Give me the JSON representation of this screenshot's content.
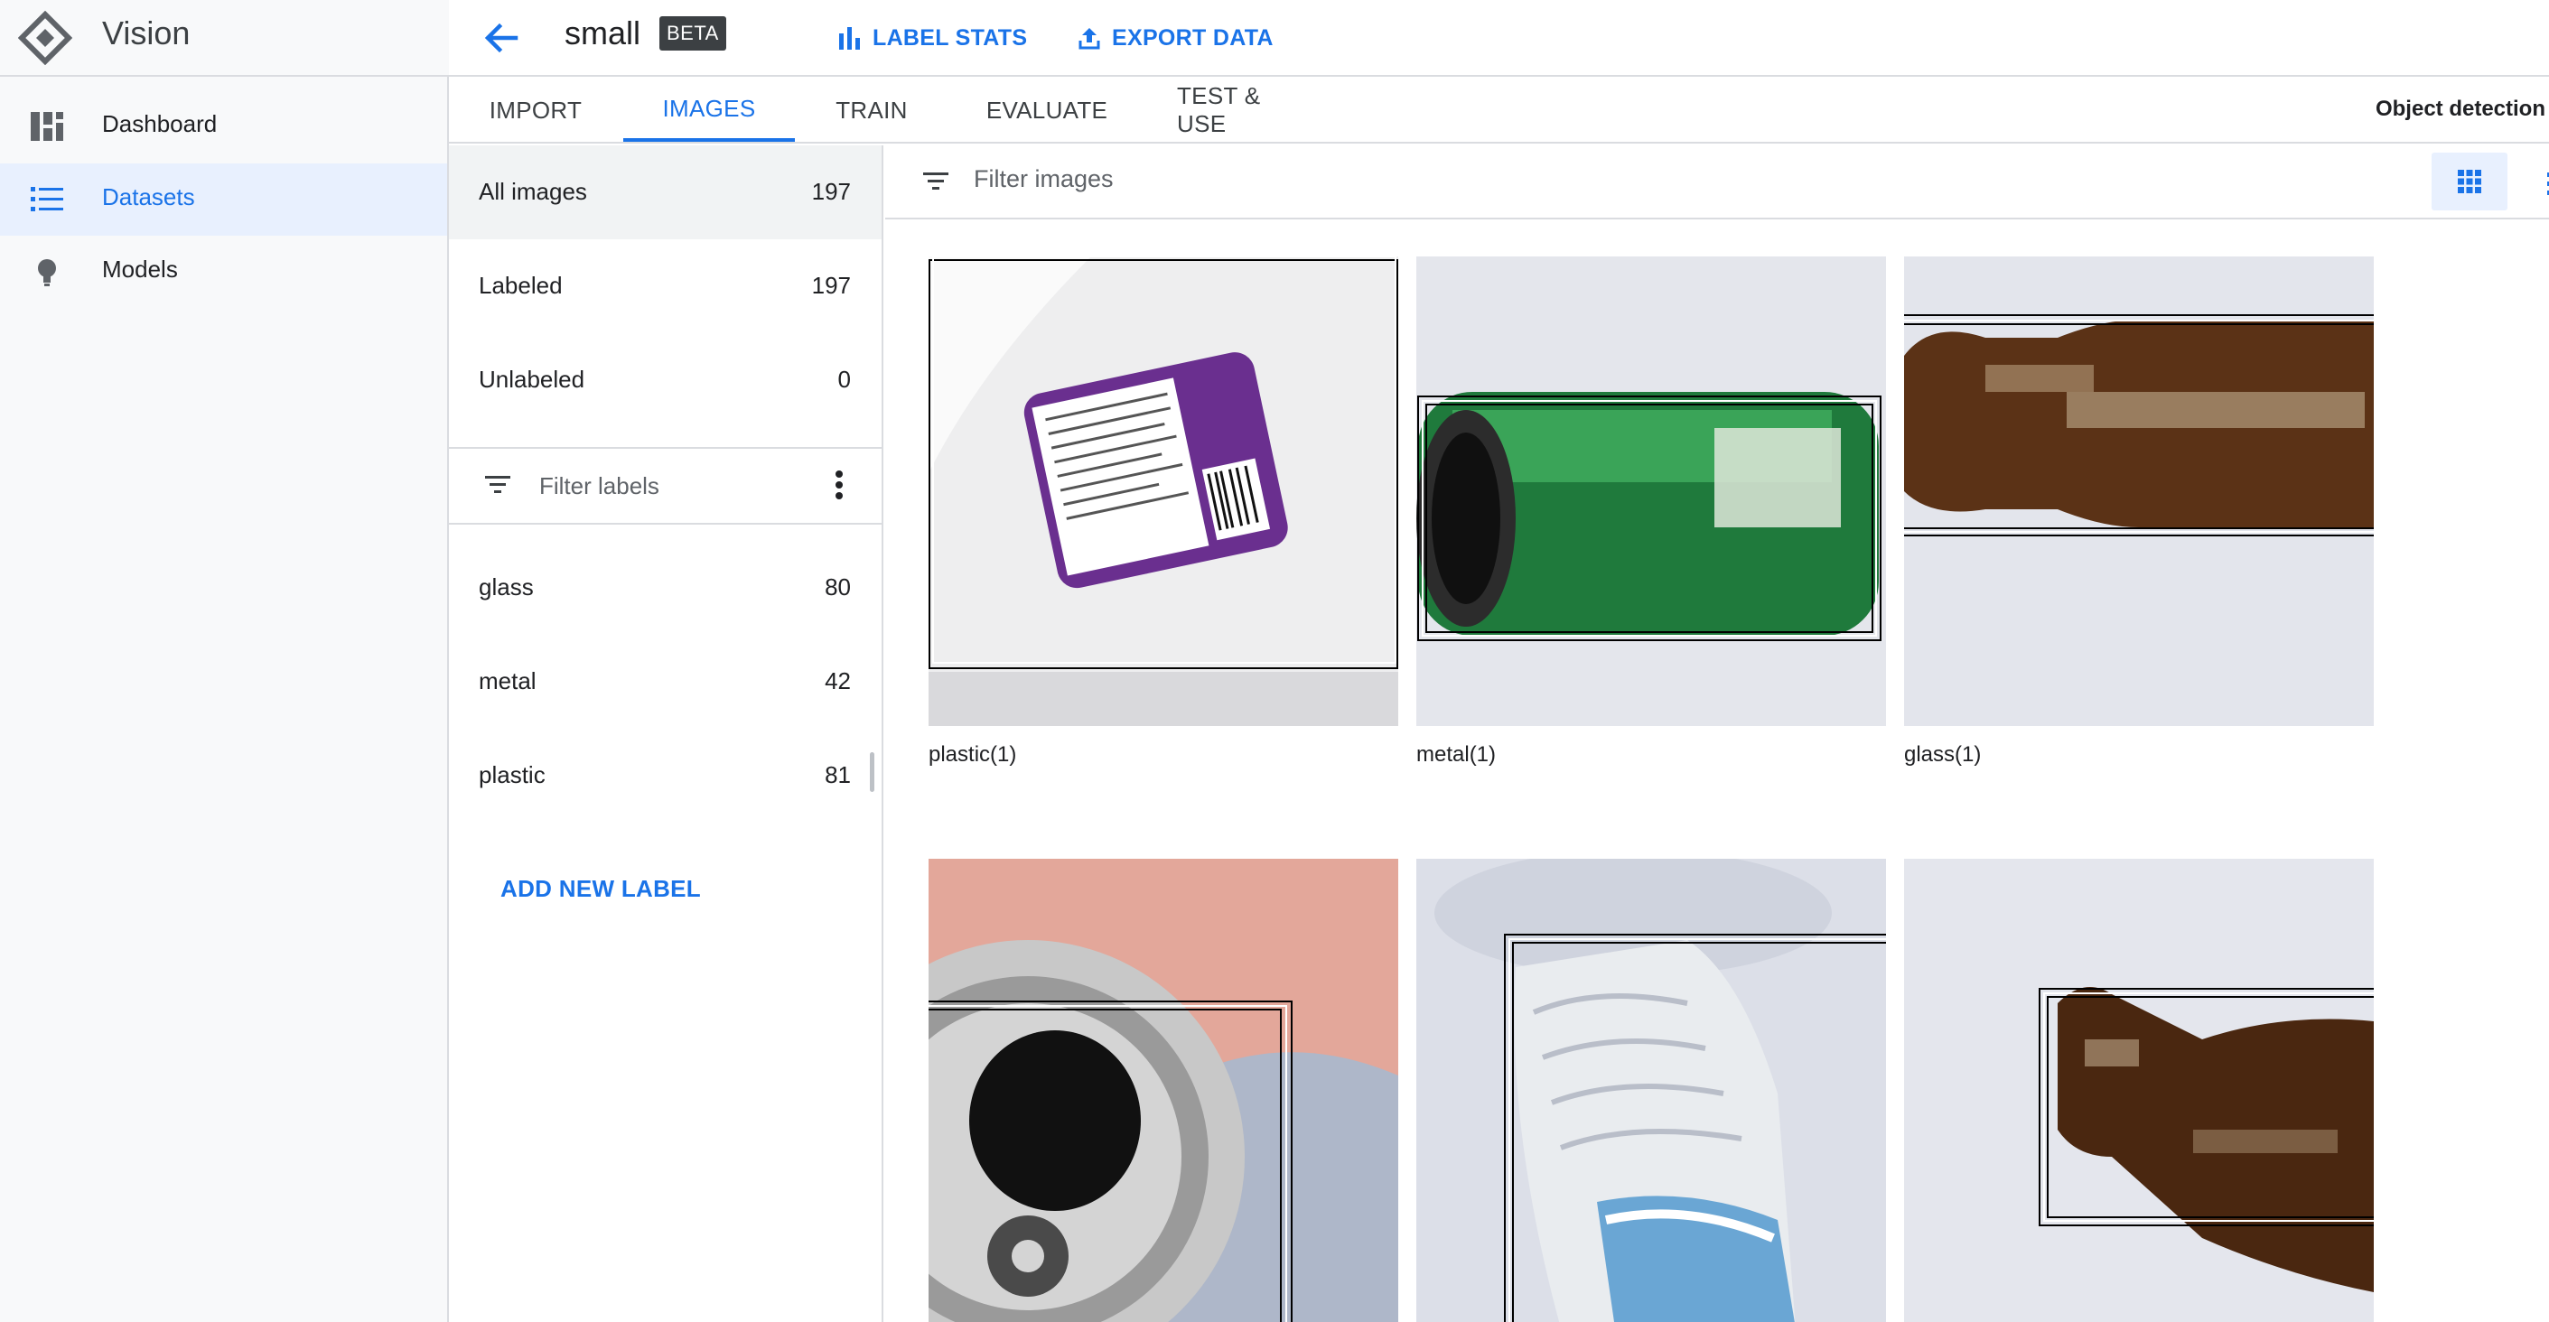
{
  "app": {
    "name": "Vision"
  },
  "nav": [
    {
      "label": "Dashboard",
      "icon": "dashboard-icon",
      "active": false
    },
    {
      "label": "Datasets",
      "icon": "list-icon",
      "active": true
    },
    {
      "label": "Models",
      "icon": "lightbulb-icon",
      "active": false
    }
  ],
  "header": {
    "dataset_name": "small",
    "badge": "BETA",
    "label_stats": "LABEL STATS",
    "export_data": "EXPORT DATA"
  },
  "tabs": [
    {
      "label": "IMPORT",
      "active": false
    },
    {
      "label": "IMAGES",
      "active": true
    },
    {
      "label": "TRAIN",
      "active": false
    },
    {
      "label": "EVALUATE",
      "active": false
    },
    {
      "label": "TEST & USE",
      "active": false
    }
  ],
  "model_type": "Object detection",
  "image_filters": [
    {
      "label": "All images",
      "count": "197",
      "selected": true
    },
    {
      "label": "Labeled",
      "count": "197",
      "selected": false
    },
    {
      "label": "Unlabeled",
      "count": "0",
      "selected": false
    }
  ],
  "label_filter_placeholder": "Filter labels",
  "labels": [
    {
      "label": "glass",
      "count": "80"
    },
    {
      "label": "metal",
      "count": "42"
    },
    {
      "label": "plastic",
      "count": "81"
    }
  ],
  "add_new_label": "ADD NEW LABEL",
  "image_filter_placeholder": "Filter images",
  "images": [
    {
      "caption": "plastic(1)",
      "kind": "milk-jug"
    },
    {
      "caption": "metal(1)",
      "kind": "green-can"
    },
    {
      "caption": "glass(1)",
      "kind": "brown-bottle"
    },
    {
      "caption": "",
      "kind": "can-top"
    },
    {
      "caption": "",
      "kind": "water-bottle"
    },
    {
      "caption": "",
      "kind": "bottle-neck"
    }
  ],
  "colors": {
    "accent": "#1a73e8",
    "active_bg": "#e8f0fe",
    "border": "#dadce0"
  }
}
